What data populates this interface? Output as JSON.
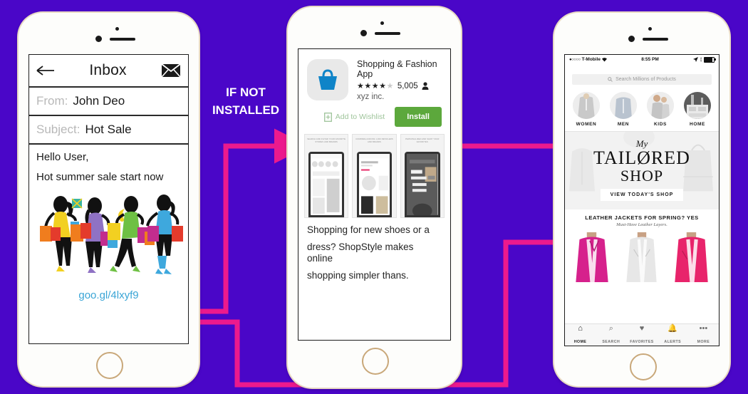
{
  "background_color": "#4a06c8",
  "accent_arrow_color": "#ec1a8d",
  "flow": {
    "label": "IF NOT INSTALLED",
    "label_line1": "IF NOT",
    "label_line2": "INSTALLED"
  },
  "phone1": {
    "name": "email-inbox-phone",
    "header": {
      "back_icon": "back-arrow-icon",
      "title": "Inbox",
      "mail_icon": "envelope-icon"
    },
    "fields": [
      {
        "label": "From:",
        "value": "John Deo"
      },
      {
        "label": "Subject:",
        "value": "Hot Sale"
      }
    ],
    "body_lines": [
      "Hello User,",
      "Hot summer sale start now"
    ],
    "illustration": "shopping-women-illustration",
    "link": "goo.gl/4lxyf9"
  },
  "phone2": {
    "name": "app-store-phone",
    "app": {
      "icon": "shopping-basket-icon",
      "name": "Shopping & Fashion App",
      "stars_filled": 4,
      "stars_total": 5,
      "rating_count": "5,005",
      "person_icon": "person-icon",
      "developer": "xyz inc."
    },
    "actions": {
      "wishlist_icon": "bookmark-add-icon",
      "wishlist_label": "Add to Wishlist",
      "install_label": "Install",
      "install_color": "#5ca83c"
    },
    "screenshots": [
      {
        "caption": "SEARCH AND FILTER YOUR FAVORITE STORES AND BRANDS"
      },
      {
        "caption": "COMPARE ACROSS 1,000 RETAILERS AND BRANDS"
      },
      {
        "caption": "PERSONALIZED AND SHOP YOUR FAVORITES"
      }
    ],
    "description_lines": [
      "Shopping for new shoes or a",
      "dress? ShopStyle makes online",
      "shopping simpler thans."
    ]
  },
  "phone3": {
    "name": "shopping-app-phone",
    "statusbar": {
      "signal_dots": "●○○○○",
      "carrier": "T-Mobile",
      "wifi_icon": "wifi-icon",
      "time": "8:55 PM",
      "location_icon": "location-arrow-icon",
      "bluetooth_icon": "bluetooth-icon",
      "battery_icon": "battery-icon"
    },
    "search": {
      "icon": "search-icon",
      "placeholder": "Search Millions of Products"
    },
    "categories": [
      {
        "label": "WOMEN"
      },
      {
        "label": "MEN"
      },
      {
        "label": "KIDS"
      },
      {
        "label": "HOME"
      }
    ],
    "hero": {
      "pretitle": "My",
      "title_line1": "TAILØRED",
      "title_line2": "SHOP",
      "cta": "VIEW TODAY'S SHOP"
    },
    "promo": {
      "headline": "LEATHER JACKETS FOR SPRING? YES",
      "subhead": "Must-Have Leather Layers."
    },
    "tabs": [
      {
        "label": "HOME",
        "icon": "home-icon",
        "glyph": "⌂",
        "active": true
      },
      {
        "label": "SEARCH",
        "icon": "search-icon",
        "glyph": "🔍",
        "active": false
      },
      {
        "label": "FAVORITES",
        "icon": "heart-icon",
        "glyph": "♥",
        "active": false
      },
      {
        "label": "ALERTS",
        "icon": "bell-icon",
        "glyph": "🔔",
        "active": false
      },
      {
        "label": "MORE",
        "icon": "ellipsis-icon",
        "glyph": "•••",
        "active": false
      }
    ]
  }
}
